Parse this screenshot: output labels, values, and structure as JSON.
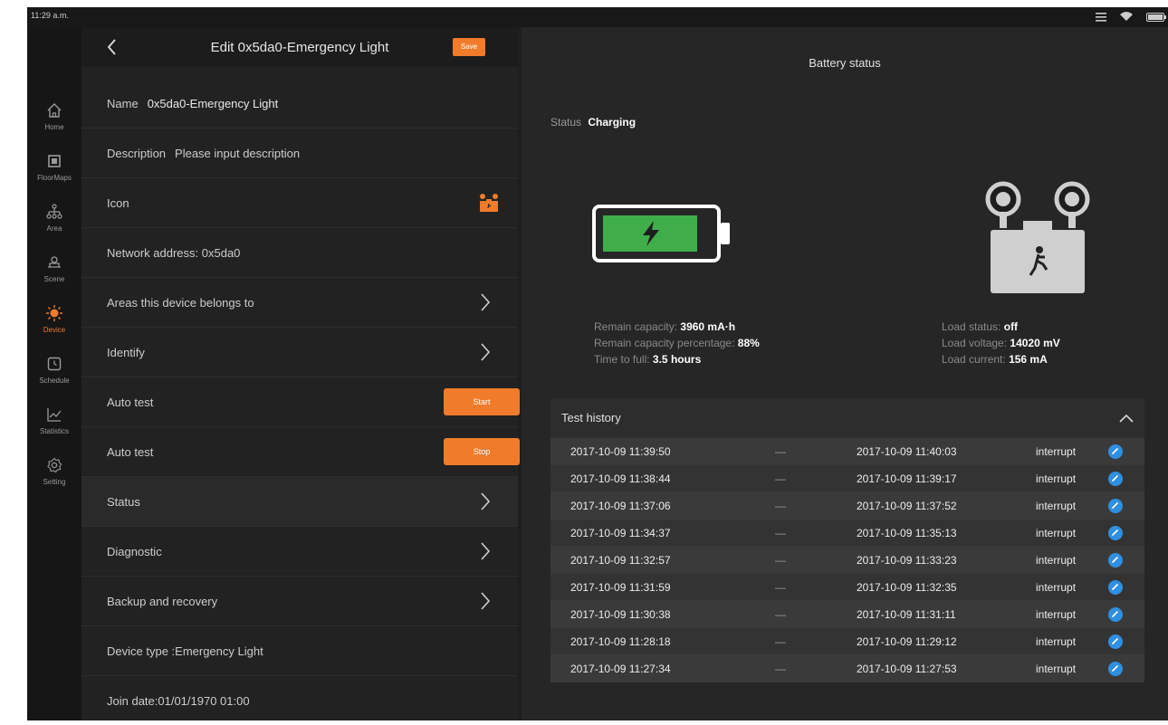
{
  "statusbar": {
    "time": "11:29 a.m."
  },
  "sidebar": {
    "items": [
      {
        "label": "Home",
        "icon": "home-icon"
      },
      {
        "label": "FloorMaps",
        "icon": "floormap-icon"
      },
      {
        "label": "Area",
        "icon": "area-icon"
      },
      {
        "label": "Scene",
        "icon": "scene-icon"
      },
      {
        "label": "Device",
        "icon": "device-icon",
        "active": true
      },
      {
        "label": "Schedule",
        "icon": "clock-icon"
      },
      {
        "label": "Statistics",
        "icon": "chart-icon"
      },
      {
        "label": "Setting",
        "icon": "gear-icon"
      }
    ]
  },
  "left": {
    "title": "Edit 0x5da0-Emergency Light",
    "save_label": "Save",
    "name_label": "Name",
    "name_value": "0x5da0-Emergency Light",
    "description_label": "Description",
    "description_placeholder": "Please input description",
    "icon_label": "Icon",
    "network_address": "Network address:  0x5da0",
    "areas": "Areas this device belongs to",
    "identify": "Identify",
    "auto_test_1": "Auto test",
    "start_label": "Start",
    "auto_test_2": "Auto test",
    "stop_label": "Stop",
    "status": "Status",
    "diagnostic": "Diagnostic",
    "backup": "Backup and recovery",
    "device_type": "Device type :Emergency Light",
    "join_date": "Join date:01/01/1970 01:00"
  },
  "right": {
    "title": "Battery status",
    "status_label": "Status",
    "status_value": "Charging",
    "battery_level_percent": 88,
    "remain_capacity_label": "Remain capacity:",
    "remain_capacity_value": "3960 mA·h",
    "remain_pct_label": "Remain capacity percentage:",
    "remain_pct_value": "88%",
    "time_to_full_label": "Time to full:",
    "time_to_full_value": "3.5 hours",
    "load_status_label": "Load status:",
    "load_status_value": "off",
    "load_voltage_label": "Load voltage:",
    "load_voltage_value": "14020 mV",
    "load_current_label": "Load current:",
    "load_current_value": "156 mA",
    "history_title": "Test history",
    "history": [
      {
        "start": "2017-10-09 11:39:50",
        "sep": "—",
        "end": "2017-10-09 11:40:03",
        "result": "interrupt"
      },
      {
        "start": "2017-10-09 11:38:44",
        "sep": "—",
        "end": "2017-10-09 11:39:17",
        "result": "interrupt"
      },
      {
        "start": "2017-10-09 11:37:06",
        "sep": "—",
        "end": "2017-10-09 11:37:52",
        "result": "interrupt"
      },
      {
        "start": "2017-10-09 11:34:37",
        "sep": "—",
        "end": "2017-10-09 11:35:13",
        "result": "interrupt"
      },
      {
        "start": "2017-10-09 11:32:57",
        "sep": "—",
        "end": "2017-10-09 11:33:23",
        "result": "interrupt"
      },
      {
        "start": "2017-10-09 11:31:59",
        "sep": "—",
        "end": "2017-10-09 11:32:35",
        "result": "interrupt"
      },
      {
        "start": "2017-10-09 11:30:38",
        "sep": "—",
        "end": "2017-10-09 11:31:11",
        "result": "interrupt"
      },
      {
        "start": "2017-10-09 11:28:18",
        "sep": "—",
        "end": "2017-10-09 11:29:12",
        "result": "interrupt"
      },
      {
        "start": "2017-10-09 11:27:34",
        "sep": "—",
        "end": "2017-10-09 11:27:53",
        "result": "interrupt"
      }
    ]
  },
  "colors": {
    "accent": "#f07b2a",
    "check": "#2f8fe0",
    "battery_fill": "#3fae4a"
  }
}
